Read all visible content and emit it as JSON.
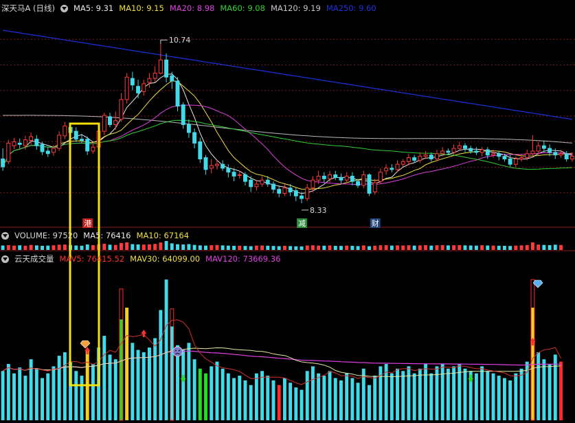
{
  "colors": {
    "up": "#ff3b3b",
    "down": "#42d9e8",
    "ma5": "#e8e8e8",
    "ma10": "#f0e040",
    "ma20": "#e040e0",
    "ma60": "#30d030",
    "ma120": "#b8b8b8",
    "ma250": "#2030e0",
    "grid": "#7a1a1a",
    "highlight": "#f5e00a",
    "bar_red": "#ff2a2a",
    "bar_yellow": "#f5d020",
    "bar_green": "#22dd22",
    "bar_cyan": "#42d9e8",
    "mav_line": "#d23030",
    "mav30_line": "#e8e8a0",
    "mav120_line": "#e040e0"
  },
  "price_panel": {
    "title": "深天马A (日线)",
    "ma_labels": [
      "MA5: 9.31",
      "MA10: 9.15",
      "MA20: 8.98",
      "MA60: 9.08",
      "MA120: 9.19",
      "MA250: 9.60"
    ],
    "ma_colors": [
      "#e8e8e8",
      "#f0e040",
      "#e040e0",
      "#30d030",
      "#c8c8c8",
      "#2030e0"
    ],
    "high_label": "10.74",
    "low_label": "8.33",
    "event_tags": [
      {
        "text": "港",
        "bg": "#c42020"
      },
      {
        "text": "减",
        "bg": "#2a8a3a"
      },
      {
        "text": "财",
        "bg": "#24447a"
      }
    ]
  },
  "volume_panel": {
    "title": "VOLUME: 97520",
    "labels": [
      "MA5: 76416",
      "MA10: 67164"
    ],
    "label_colors": [
      "#e8e8e8",
      "#f0e040"
    ]
  },
  "indicator_panel": {
    "title": "云天成交量",
    "labels": [
      "MAV5: 76415.52",
      "MAV30: 64099.00",
      "MAV120: 73669.36"
    ],
    "label_colors": [
      "#ff3030",
      "#f0e040",
      "#e040e0"
    ]
  },
  "chart_data": [
    {
      "type": "candlestick",
      "title": "深天马A (日线)",
      "annotations": [
        {
          "label": "10.74",
          "type": "high"
        },
        {
          "label": "8.33",
          "type": "low"
        }
      ],
      "candles": [
        [
          9.0,
          8.88,
          9.16,
          8.82
        ],
        [
          8.96,
          9.24,
          9.29,
          8.92
        ],
        [
          9.2,
          9.26,
          9.32,
          9.15
        ],
        [
          9.24,
          9.22,
          9.31,
          9.16
        ],
        [
          9.2,
          9.29,
          9.35,
          9.14
        ],
        [
          9.28,
          9.34,
          9.4,
          9.22
        ],
        [
          9.3,
          9.2,
          9.36,
          9.14
        ],
        [
          9.22,
          9.11,
          9.26,
          9.06
        ],
        [
          9.12,
          9.08,
          9.18,
          9.03
        ],
        [
          9.1,
          9.16,
          9.21,
          9.05
        ],
        [
          9.16,
          9.36,
          9.42,
          9.12
        ],
        [
          9.35,
          9.5,
          9.56,
          9.3
        ],
        [
          9.48,
          9.4,
          9.54,
          9.34
        ],
        [
          9.42,
          9.3,
          9.48,
          9.26
        ],
        [
          9.3,
          9.28,
          9.38,
          9.24
        ],
        [
          9.3,
          9.12,
          9.34,
          9.06
        ],
        [
          9.12,
          9.18,
          9.24,
          9.08
        ],
        [
          9.18,
          9.42,
          9.48,
          9.12
        ],
        [
          9.42,
          9.66,
          9.7,
          9.36
        ],
        [
          9.64,
          9.52,
          9.7,
          9.48
        ],
        [
          9.52,
          9.58,
          9.72,
          9.44
        ],
        [
          9.6,
          9.9,
          10.0,
          9.56
        ],
        [
          9.9,
          10.24,
          10.3,
          9.84
        ],
        [
          10.22,
          10.12,
          10.32,
          10.04
        ],
        [
          10.1,
          10.0,
          10.2,
          9.92
        ],
        [
          10.02,
          10.14,
          10.2,
          9.96
        ],
        [
          10.16,
          10.22,
          10.3,
          10.08
        ],
        [
          10.22,
          10.3,
          10.4,
          10.16
        ],
        [
          10.3,
          10.5,
          10.74,
          10.28
        ],
        [
          10.5,
          10.24,
          10.6,
          10.16
        ],
        [
          10.26,
          10.18,
          10.32,
          10.06
        ],
        [
          10.18,
          9.8,
          10.24,
          9.72
        ],
        [
          9.82,
          9.52,
          9.86,
          9.46
        ],
        [
          9.52,
          9.4,
          9.6,
          9.32
        ],
        [
          9.4,
          9.24,
          9.46,
          9.16
        ],
        [
          9.26,
          9.0,
          9.32,
          8.94
        ],
        [
          9.02,
          8.84,
          9.06,
          8.76
        ],
        [
          8.86,
          8.9,
          9.0,
          8.78
        ],
        [
          8.9,
          8.92,
          8.98,
          8.84
        ],
        [
          8.92,
          8.86,
          8.98,
          8.82
        ],
        [
          8.86,
          8.8,
          8.92,
          8.72
        ],
        [
          8.8,
          8.74,
          8.86,
          8.66
        ],
        [
          8.76,
          8.76,
          8.82,
          8.7
        ],
        [
          8.76,
          8.66,
          8.8,
          8.6
        ],
        [
          8.68,
          8.58,
          8.74,
          8.5
        ],
        [
          8.58,
          8.62,
          8.68,
          8.52
        ],
        [
          8.62,
          8.68,
          8.74,
          8.58
        ],
        [
          8.68,
          8.62,
          8.74,
          8.58
        ],
        [
          8.62,
          8.54,
          8.66,
          8.48
        ],
        [
          8.54,
          8.48,
          8.6,
          8.42
        ],
        [
          8.48,
          8.56,
          8.62,
          8.44
        ],
        [
          8.56,
          8.5,
          8.62,
          8.44
        ],
        [
          8.52,
          8.44,
          8.56,
          8.36
        ],
        [
          8.44,
          8.4,
          8.5,
          8.33
        ],
        [
          8.4,
          8.56,
          8.62,
          8.36
        ],
        [
          8.56,
          8.68,
          8.74,
          8.5
        ],
        [
          8.68,
          8.74,
          8.82,
          8.62
        ],
        [
          8.74,
          8.7,
          8.8,
          8.64
        ],
        [
          8.7,
          8.76,
          8.82,
          8.64
        ],
        [
          8.76,
          8.72,
          8.82,
          8.68
        ],
        [
          8.72,
          8.68,
          8.78,
          8.62
        ],
        [
          8.68,
          8.74,
          8.8,
          8.64
        ],
        [
          8.74,
          8.66,
          8.8,
          8.6
        ],
        [
          8.66,
          8.6,
          8.7,
          8.56
        ],
        [
          8.6,
          8.76,
          8.82,
          8.56
        ],
        [
          8.76,
          8.48,
          8.78,
          8.44
        ],
        [
          8.5,
          8.64,
          8.7,
          8.46
        ],
        [
          8.66,
          8.8,
          8.86,
          8.62
        ],
        [
          8.82,
          8.86,
          8.92,
          8.76
        ],
        [
          8.86,
          8.84,
          8.92,
          8.8
        ],
        [
          8.84,
          8.92,
          8.98,
          8.8
        ],
        [
          8.92,
          8.96,
          9.0,
          8.88
        ],
        [
          8.96,
          9.02,
          9.08,
          8.9
        ],
        [
          9.02,
          8.98,
          9.06,
          8.94
        ],
        [
          8.98,
          9.04,
          9.1,
          8.94
        ],
        [
          9.04,
          9.06,
          9.12,
          9.0
        ],
        [
          9.06,
          9.0,
          9.1,
          8.96
        ],
        [
          9.0,
          9.08,
          9.14,
          8.96
        ],
        [
          9.08,
          9.12,
          9.18,
          9.04
        ],
        [
          9.12,
          9.1,
          9.16,
          9.06
        ],
        [
          9.1,
          9.16,
          9.22,
          9.06
        ],
        [
          9.16,
          9.2,
          9.26,
          9.12
        ],
        [
          9.2,
          9.16,
          9.24,
          9.1
        ],
        [
          9.16,
          9.12,
          9.2,
          9.08
        ],
        [
          9.12,
          9.1,
          9.18,
          9.06
        ],
        [
          9.1,
          9.14,
          9.18,
          9.04
        ],
        [
          9.14,
          9.06,
          9.18,
          9.0
        ],
        [
          9.06,
          9.08,
          9.14,
          9.02
        ],
        [
          9.08,
          9.04,
          9.12,
          8.98
        ],
        [
          9.04,
          9.0,
          9.08,
          8.96
        ],
        [
          9.0,
          8.92,
          9.06,
          8.88
        ],
        [
          8.92,
          9.0,
          9.04,
          8.88
        ],
        [
          9.0,
          9.02,
          9.08,
          8.96
        ],
        [
          9.02,
          9.08,
          9.14,
          8.98
        ],
        [
          9.08,
          9.12,
          9.36,
          9.04
        ],
        [
          9.12,
          9.2,
          9.26,
          9.06
        ],
        [
          9.2,
          9.16,
          9.28,
          9.1
        ],
        [
          9.16,
          9.1,
          9.22,
          9.04
        ],
        [
          9.1,
          9.06,
          9.16,
          9.0
        ],
        [
          9.06,
          9.08,
          9.14,
          9.02
        ],
        [
          9.08,
          9.0,
          9.12,
          8.96
        ],
        [
          9.0,
          9.04,
          9.1,
          8.96
        ]
      ],
      "ma5_last": 9.31,
      "ma10_last": 9.15,
      "ma20_last": 8.98,
      "ma60_last": 9.08,
      "ma120_last": 9.19,
      "ma250_last": 9.6
    },
    {
      "type": "bar",
      "title": "云天成交量",
      "values": [
        42,
        48,
        40,
        45,
        38,
        52,
        44,
        36,
        40,
        46,
        55,
        58,
        50,
        42,
        38,
        60,
        48,
        62,
        72,
        56,
        52,
        86,
        96,
        66,
        60,
        58,
        62,
        70,
        94,
        120,
        80,
        64,
        60,
        66,
        52,
        44,
        40,
        46,
        50,
        44,
        40,
        36,
        38,
        34,
        30,
        40,
        42,
        38,
        34,
        30,
        36,
        32,
        28,
        26,
        42,
        46,
        40,
        38,
        42,
        36,
        34,
        40,
        36,
        32,
        44,
        30,
        38,
        46,
        48,
        40,
        44,
        42,
        46,
        40,
        44,
        48,
        40,
        46,
        48,
        44,
        46,
        48,
        44,
        42,
        40,
        46,
        42,
        40,
        38,
        36,
        34,
        40,
        44,
        50,
        96,
        58,
        52,
        48,
        56,
        50
      ],
      "colors": [
        "c",
        "c",
        "c",
        "c",
        "c",
        "c",
        "c",
        "c",
        "c",
        "c",
        "c",
        "c",
        "c",
        "c",
        "c",
        "y",
        "c",
        "c",
        "c",
        "c",
        "c",
        "g",
        "y",
        "c",
        "c",
        "c",
        "c",
        "c",
        "c",
        "c",
        "c",
        "c",
        "c",
        "c",
        "c",
        "g",
        "g",
        "c",
        "c",
        "c",
        "c",
        "c",
        "c",
        "c",
        "c",
        "c",
        "c",
        "c",
        "c",
        "r",
        "c",
        "c",
        "c",
        "c",
        "c",
        "c",
        "c",
        "c",
        "c",
        "c",
        "c",
        "c",
        "c",
        "c",
        "c",
        "c",
        "c",
        "c",
        "c",
        "c",
        "c",
        "c",
        "c",
        "c",
        "c",
        "c",
        "c",
        "c",
        "c",
        "c",
        "c",
        "c",
        "c",
        "c",
        "c",
        "c",
        "c",
        "c",
        "c",
        "c",
        "c",
        "c",
        "c",
        "c",
        "y",
        "c",
        "c",
        "c",
        "c",
        "r"
      ],
      "series": [
        {
          "name": "MAV5"
        },
        {
          "name": "MAV30"
        },
        {
          "name": "MAV120"
        }
      ]
    }
  ]
}
